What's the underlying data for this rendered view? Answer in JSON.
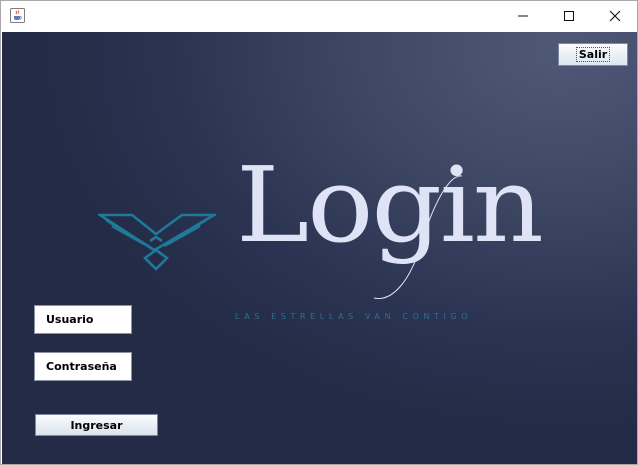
{
  "window": {
    "app_icon": "java-cup-icon",
    "controls": {
      "minimize": "minimize-icon",
      "maximize": "maximize-icon",
      "close": "close-icon"
    }
  },
  "header": {
    "exit_label": "Salir"
  },
  "logo": {
    "icon": "winged-emblem-icon",
    "title": "Login",
    "tagline": "LAS ESTRELLAS VAN CONTIGO"
  },
  "form": {
    "user_label": "Usuario",
    "password_label": "Contraseña",
    "submit_label": "Ingresar"
  },
  "colors": {
    "background_dark": "#232b46",
    "background_light": "#505878",
    "emblem_teal": "#1e7a98",
    "title_text": "#dfe3f6",
    "tagline_text": "#2f6e92"
  }
}
